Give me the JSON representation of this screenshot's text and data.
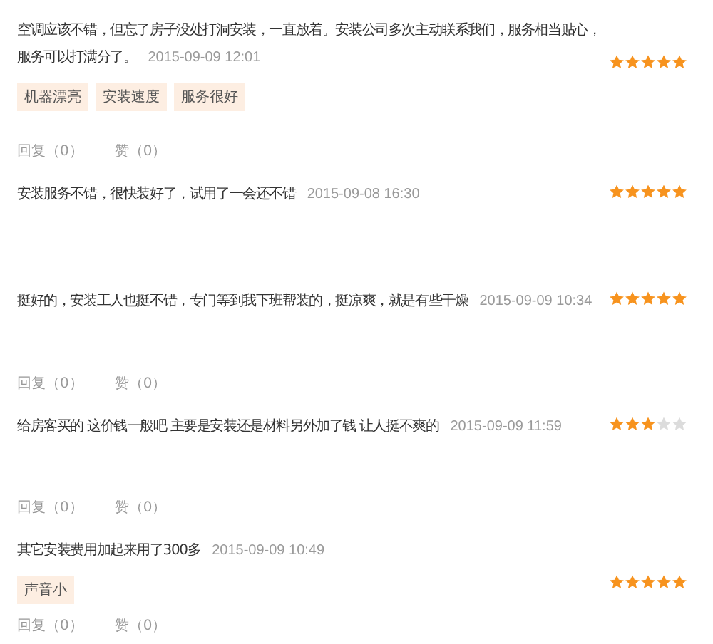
{
  "reviews": [
    {
      "text_lines": [
        "空调应该不错，但忘了房子没处打洞安装，一直放着。安装公司多次主动联系我们，服务相当贴心，",
        "服务可以打满分了。"
      ],
      "date": "2015-09-09 12:01",
      "stars": 5,
      "tags": [
        "机器漂亮",
        "安装速度",
        "服务很好"
      ],
      "reply": "回复（0）",
      "like": "赞（0）"
    },
    {
      "text": "安装服务不错，很快装好了，试用了一会还不错",
      "date": "2015-09-08 16:30",
      "stars": 5
    },
    {
      "text": "挺好的，安装工人也挺不错，专门等到我下班帮装的，挺凉爽，就是有些干燥",
      "date": "2015-09-09 10:34",
      "stars": 5,
      "reply": "回复（0）",
      "like": "赞（0）"
    },
    {
      "text": "给房客买的 这价钱一般吧 主要是安装还是材料另外加了钱 让人挺不爽的",
      "date": "2015-09-09 11:59",
      "stars": 3,
      "reply": "回复（0）",
      "like": "赞（0）"
    },
    {
      "text": "其它安装费用加起来用了300多",
      "date": "2015-09-09 10:49",
      "stars": 5,
      "tags": [
        "声音小"
      ],
      "reply": "回复（0）",
      "like": "赞（0）"
    }
  ]
}
